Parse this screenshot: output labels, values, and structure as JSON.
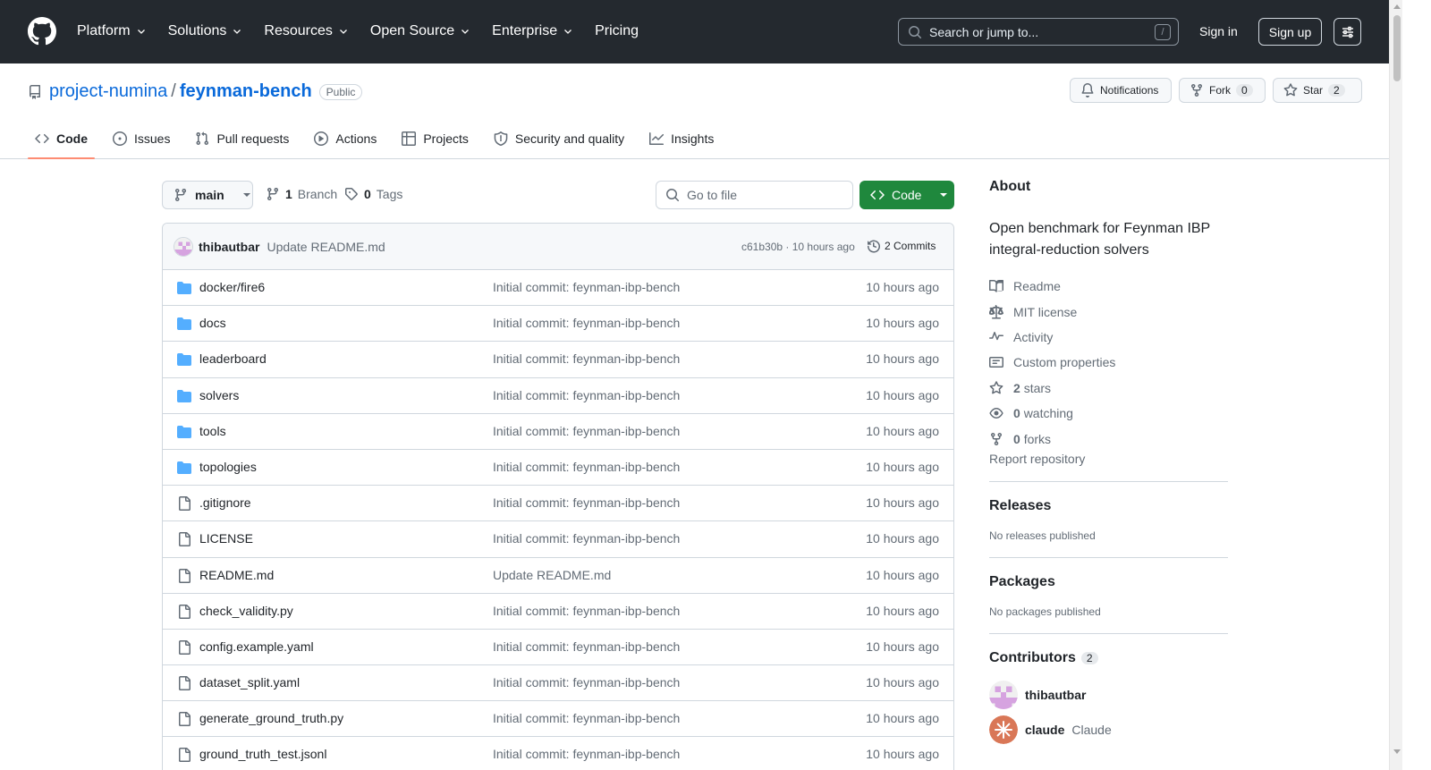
{
  "header": {
    "nav": [
      {
        "label": "Platform",
        "dropdown": true
      },
      {
        "label": "Solutions",
        "dropdown": true
      },
      {
        "label": "Resources",
        "dropdown": true
      },
      {
        "label": "Open Source",
        "dropdown": true
      },
      {
        "label": "Enterprise",
        "dropdown": true
      },
      {
        "label": "Pricing",
        "dropdown": false
      }
    ],
    "search_placeholder": "Search or jump to...",
    "search_shortcut": "/",
    "signin": "Sign in",
    "signup": "Sign up"
  },
  "repo": {
    "owner": "project-numina",
    "separator": "/",
    "name": "feynman-bench",
    "visibility": "Public",
    "notifications_label": "Notifications",
    "fork_label": "Fork",
    "fork_count": "0",
    "star_label": "Star",
    "star_count": "2"
  },
  "tabs": [
    {
      "label": "Code",
      "icon": "code-icon",
      "active": true
    },
    {
      "label": "Issues",
      "icon": "issue-icon",
      "active": false
    },
    {
      "label": "Pull requests",
      "icon": "pull-request-icon",
      "active": false
    },
    {
      "label": "Actions",
      "icon": "play-icon",
      "active": false
    },
    {
      "label": "Projects",
      "icon": "table-icon",
      "active": false
    },
    {
      "label": "Security and quality",
      "icon": "shield-icon",
      "active": false
    },
    {
      "label": "Insights",
      "icon": "graph-icon",
      "active": false
    }
  ],
  "branch_bar": {
    "branch": "main",
    "branch_count": "1",
    "branch_word": "Branch",
    "tag_count": "0",
    "tag_word": "Tags",
    "goto_placeholder": "Go to file",
    "code_button": "Code"
  },
  "commit": {
    "author": "thibautbar",
    "message": "Update README.md",
    "meta": "c61b30b · 10 hours ago",
    "commits": "2 Commits"
  },
  "files": [
    {
      "type": "dir",
      "name": "docker/fire6",
      "message": "Initial commit: feynman-ibp-bench",
      "time": "10 hours ago"
    },
    {
      "type": "dir",
      "name": "docs",
      "message": "Initial commit: feynman-ibp-bench",
      "time": "10 hours ago"
    },
    {
      "type": "dir",
      "name": "leaderboard",
      "message": "Initial commit: feynman-ibp-bench",
      "time": "10 hours ago"
    },
    {
      "type": "dir",
      "name": "solvers",
      "message": "Initial commit: feynman-ibp-bench",
      "time": "10 hours ago"
    },
    {
      "type": "dir",
      "name": "tools",
      "message": "Initial commit: feynman-ibp-bench",
      "time": "10 hours ago"
    },
    {
      "type": "dir",
      "name": "topologies",
      "message": "Initial commit: feynman-ibp-bench",
      "time": "10 hours ago"
    },
    {
      "type": "file",
      "name": ".gitignore",
      "message": "Initial commit: feynman-ibp-bench",
      "time": "10 hours ago"
    },
    {
      "type": "file",
      "name": "LICENSE",
      "message": "Initial commit: feynman-ibp-bench",
      "time": "10 hours ago"
    },
    {
      "type": "file",
      "name": "README.md",
      "message": "Update README.md",
      "time": "10 hours ago"
    },
    {
      "type": "file",
      "name": "check_validity.py",
      "message": "Initial commit: feynman-ibp-bench",
      "time": "10 hours ago"
    },
    {
      "type": "file",
      "name": "config.example.yaml",
      "message": "Initial commit: feynman-ibp-bench",
      "time": "10 hours ago"
    },
    {
      "type": "file",
      "name": "dataset_split.yaml",
      "message": "Initial commit: feynman-ibp-bench",
      "time": "10 hours ago"
    },
    {
      "type": "file",
      "name": "generate_ground_truth.py",
      "message": "Initial commit: feynman-ibp-bench",
      "time": "10 hours ago"
    },
    {
      "type": "file",
      "name": "ground_truth_test.jsonl",
      "message": "Initial commit: feynman-ibp-bench",
      "time": "10 hours ago"
    }
  ],
  "sidebar": {
    "about_title": "About",
    "description": "Open benchmark for Feynman IBP integral-reduction solvers",
    "links": [
      {
        "icon": "book-icon",
        "label": "Readme"
      },
      {
        "icon": "law-icon",
        "label": "MIT license"
      },
      {
        "icon": "pulse-icon",
        "label": "Activity"
      },
      {
        "icon": "note-icon",
        "label": "Custom properties"
      },
      {
        "icon": "star-icon",
        "bold": "2",
        "label": "stars"
      },
      {
        "icon": "eye-icon",
        "bold": "0",
        "label": "watching"
      },
      {
        "icon": "fork-icon",
        "bold": "0",
        "label": "forks"
      }
    ],
    "report": "Report repository",
    "releases_title": "Releases",
    "releases_text": "No releases published",
    "packages_title": "Packages",
    "packages_text": "No packages published",
    "contributors_title": "Contributors",
    "contributors_count": "2",
    "contributors": [
      {
        "login": "thibautbar",
        "name": ""
      },
      {
        "login": "claude",
        "name": "Claude"
      }
    ]
  },
  "colors": {
    "header_bg": "#24292f",
    "link": "#0969da",
    "primary_button": "#1f883d",
    "folder": "#54aeff",
    "active_tab_underline": "#fd8c73"
  }
}
